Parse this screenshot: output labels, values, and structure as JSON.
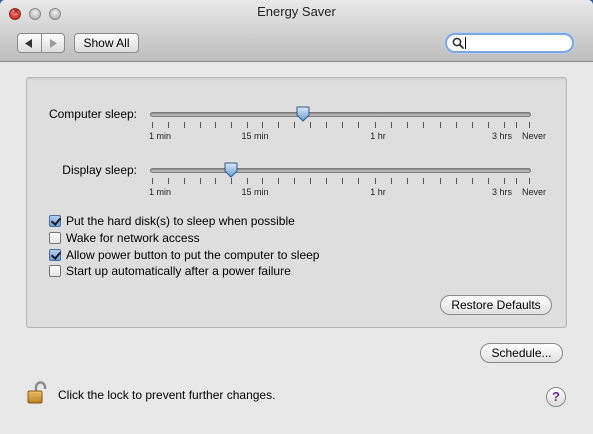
{
  "window": {
    "title": "Energy Saver"
  },
  "toolbar": {
    "back_icon": "back-triangle-icon",
    "forward_icon": "forward-triangle-icon",
    "show_all_label": "Show All",
    "search_value": ""
  },
  "sliders": {
    "computer": {
      "label": "Computer sleep:",
      "level_percent": 40,
      "tick_labels": [
        "1 min",
        "15 min",
        "1 hr",
        "3 hrs",
        "Never"
      ]
    },
    "display": {
      "label": "Display sleep:",
      "level_percent": 21,
      "tick_labels": [
        "1 min",
        "15 min",
        "1 hr",
        "3 hrs",
        "Never"
      ]
    }
  },
  "options": [
    {
      "label": "Put the hard disk(s) to sleep when possible",
      "checked": true
    },
    {
      "label": "Wake for network access",
      "checked": false
    },
    {
      "label": "Allow power button to put the computer to sleep",
      "checked": true
    },
    {
      "label": "Start up automatically after a power failure",
      "checked": false
    }
  ],
  "buttons": {
    "restore_defaults": "Restore Defaults",
    "schedule": "Schedule..."
  },
  "footer": {
    "lock_text": "Click the lock to prevent further changes.",
    "help_label": "?"
  }
}
